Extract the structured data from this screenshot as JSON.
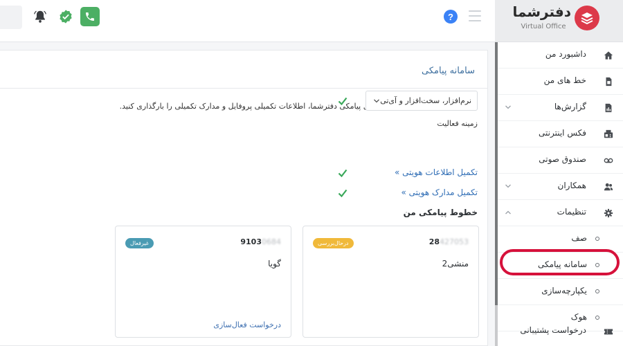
{
  "header": {
    "help_glyph": "?"
  },
  "logo": {
    "title": "دفترشما",
    "subtitle": "Virtual Office",
    "brand_color": "#dc3949"
  },
  "sidebar": {
    "items": [
      {
        "label": "داشبورد من",
        "icon": "home-icon"
      },
      {
        "label": "خط های من",
        "icon": "sim-card-icon"
      },
      {
        "label": "گزارش‌ها",
        "icon": "report-icon",
        "expandable": true
      },
      {
        "label": "فکس اینترنتی",
        "icon": "fax-icon"
      },
      {
        "label": "صندوق صوتی",
        "icon": "voicemail-icon"
      },
      {
        "label": "همکاران",
        "icon": "users-icon",
        "expandable": true
      },
      {
        "label": "تنظیمات",
        "icon": "gear-icon",
        "expanded": true
      }
    ],
    "sub_items": [
      {
        "label": "صف"
      },
      {
        "label": "سامانه پیامکی",
        "active": true
      },
      {
        "label": "یکپارچه‌سازی"
      },
      {
        "label": "هوک"
      }
    ],
    "support": {
      "label": "درخواست پشتیبانی",
      "icon": "ticket-icon"
    },
    "highlight_color": "#d6113b"
  },
  "main": {
    "title": "سامانه پیامکی",
    "notice": "در صورت تمایل به استفاده از پنل پیامکی دفترشما، اطلاعات تکمیلی پروفایل و مدارک تکمیلی را بارگذاری کنید.",
    "activity_label": "زمینه فعالیت",
    "activity_value": "نرم‌افزار، سخت‌افزار و آی‌تی",
    "links": [
      {
        "label": "تکمیل اطلاعات هویتی »"
      },
      {
        "label": "تکمیل مدارک هویتی »"
      }
    ],
    "lines_title": "خطوط پیامکی من",
    "lines": [
      {
        "number_visible": "28",
        "number_masked": "427053",
        "status": "درحال‌بررسی",
        "status_color": "#f0b93a",
        "name": "منشی2"
      },
      {
        "number_visible": "9103",
        "number_masked": "0684",
        "status": "غیرفعال",
        "status_color": "#4a9bb3",
        "name": "گویا",
        "action": "درخواست فعال‌سازی"
      }
    ]
  }
}
